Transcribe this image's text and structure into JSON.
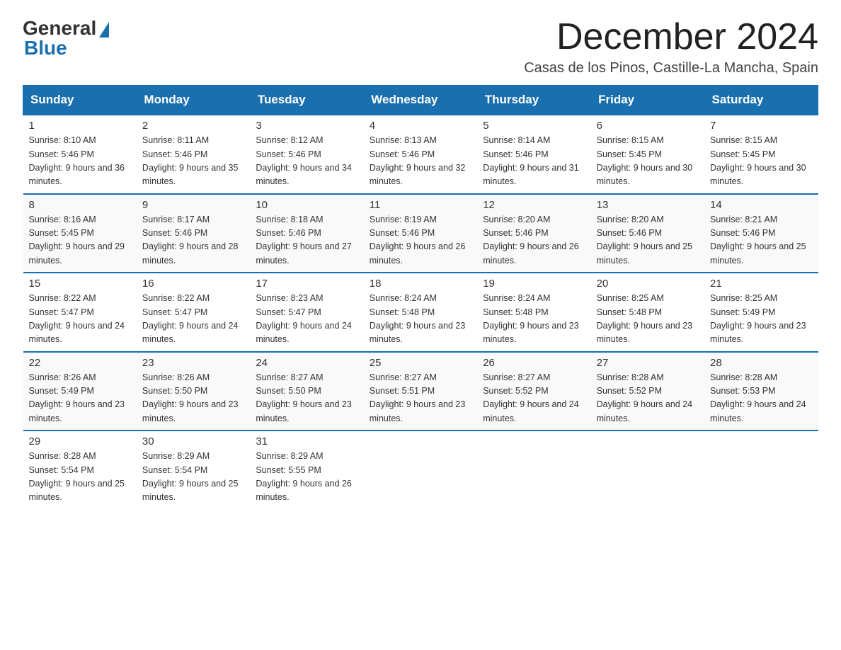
{
  "header": {
    "logo_general": "General",
    "logo_blue": "Blue",
    "month_title": "December 2024",
    "location": "Casas de los Pinos, Castille-La Mancha, Spain"
  },
  "weekdays": [
    "Sunday",
    "Monday",
    "Tuesday",
    "Wednesday",
    "Thursday",
    "Friday",
    "Saturday"
  ],
  "weeks": [
    [
      {
        "day": "1",
        "sunrise": "8:10 AM",
        "sunset": "5:46 PM",
        "daylight": "9 hours and 36 minutes."
      },
      {
        "day": "2",
        "sunrise": "8:11 AM",
        "sunset": "5:46 PM",
        "daylight": "9 hours and 35 minutes."
      },
      {
        "day": "3",
        "sunrise": "8:12 AM",
        "sunset": "5:46 PM",
        "daylight": "9 hours and 34 minutes."
      },
      {
        "day": "4",
        "sunrise": "8:13 AM",
        "sunset": "5:46 PM",
        "daylight": "9 hours and 32 minutes."
      },
      {
        "day": "5",
        "sunrise": "8:14 AM",
        "sunset": "5:46 PM",
        "daylight": "9 hours and 31 minutes."
      },
      {
        "day": "6",
        "sunrise": "8:15 AM",
        "sunset": "5:45 PM",
        "daylight": "9 hours and 30 minutes."
      },
      {
        "day": "7",
        "sunrise": "8:15 AM",
        "sunset": "5:45 PM",
        "daylight": "9 hours and 30 minutes."
      }
    ],
    [
      {
        "day": "8",
        "sunrise": "8:16 AM",
        "sunset": "5:45 PM",
        "daylight": "9 hours and 29 minutes."
      },
      {
        "day": "9",
        "sunrise": "8:17 AM",
        "sunset": "5:46 PM",
        "daylight": "9 hours and 28 minutes."
      },
      {
        "day": "10",
        "sunrise": "8:18 AM",
        "sunset": "5:46 PM",
        "daylight": "9 hours and 27 minutes."
      },
      {
        "day": "11",
        "sunrise": "8:19 AM",
        "sunset": "5:46 PM",
        "daylight": "9 hours and 26 minutes."
      },
      {
        "day": "12",
        "sunrise": "8:20 AM",
        "sunset": "5:46 PM",
        "daylight": "9 hours and 26 minutes."
      },
      {
        "day": "13",
        "sunrise": "8:20 AM",
        "sunset": "5:46 PM",
        "daylight": "9 hours and 25 minutes."
      },
      {
        "day": "14",
        "sunrise": "8:21 AM",
        "sunset": "5:46 PM",
        "daylight": "9 hours and 25 minutes."
      }
    ],
    [
      {
        "day": "15",
        "sunrise": "8:22 AM",
        "sunset": "5:47 PM",
        "daylight": "9 hours and 24 minutes."
      },
      {
        "day": "16",
        "sunrise": "8:22 AM",
        "sunset": "5:47 PM",
        "daylight": "9 hours and 24 minutes."
      },
      {
        "day": "17",
        "sunrise": "8:23 AM",
        "sunset": "5:47 PM",
        "daylight": "9 hours and 24 minutes."
      },
      {
        "day": "18",
        "sunrise": "8:24 AM",
        "sunset": "5:48 PM",
        "daylight": "9 hours and 23 minutes."
      },
      {
        "day": "19",
        "sunrise": "8:24 AM",
        "sunset": "5:48 PM",
        "daylight": "9 hours and 23 minutes."
      },
      {
        "day": "20",
        "sunrise": "8:25 AM",
        "sunset": "5:48 PM",
        "daylight": "9 hours and 23 minutes."
      },
      {
        "day": "21",
        "sunrise": "8:25 AM",
        "sunset": "5:49 PM",
        "daylight": "9 hours and 23 minutes."
      }
    ],
    [
      {
        "day": "22",
        "sunrise": "8:26 AM",
        "sunset": "5:49 PM",
        "daylight": "9 hours and 23 minutes."
      },
      {
        "day": "23",
        "sunrise": "8:26 AM",
        "sunset": "5:50 PM",
        "daylight": "9 hours and 23 minutes."
      },
      {
        "day": "24",
        "sunrise": "8:27 AM",
        "sunset": "5:50 PM",
        "daylight": "9 hours and 23 minutes."
      },
      {
        "day": "25",
        "sunrise": "8:27 AM",
        "sunset": "5:51 PM",
        "daylight": "9 hours and 23 minutes."
      },
      {
        "day": "26",
        "sunrise": "8:27 AM",
        "sunset": "5:52 PM",
        "daylight": "9 hours and 24 minutes."
      },
      {
        "day": "27",
        "sunrise": "8:28 AM",
        "sunset": "5:52 PM",
        "daylight": "9 hours and 24 minutes."
      },
      {
        "day": "28",
        "sunrise": "8:28 AM",
        "sunset": "5:53 PM",
        "daylight": "9 hours and 24 minutes."
      }
    ],
    [
      {
        "day": "29",
        "sunrise": "8:28 AM",
        "sunset": "5:54 PM",
        "daylight": "9 hours and 25 minutes."
      },
      {
        "day": "30",
        "sunrise": "8:29 AM",
        "sunset": "5:54 PM",
        "daylight": "9 hours and 25 minutes."
      },
      {
        "day": "31",
        "sunrise": "8:29 AM",
        "sunset": "5:55 PM",
        "daylight": "9 hours and 26 minutes."
      },
      null,
      null,
      null,
      null
    ]
  ]
}
